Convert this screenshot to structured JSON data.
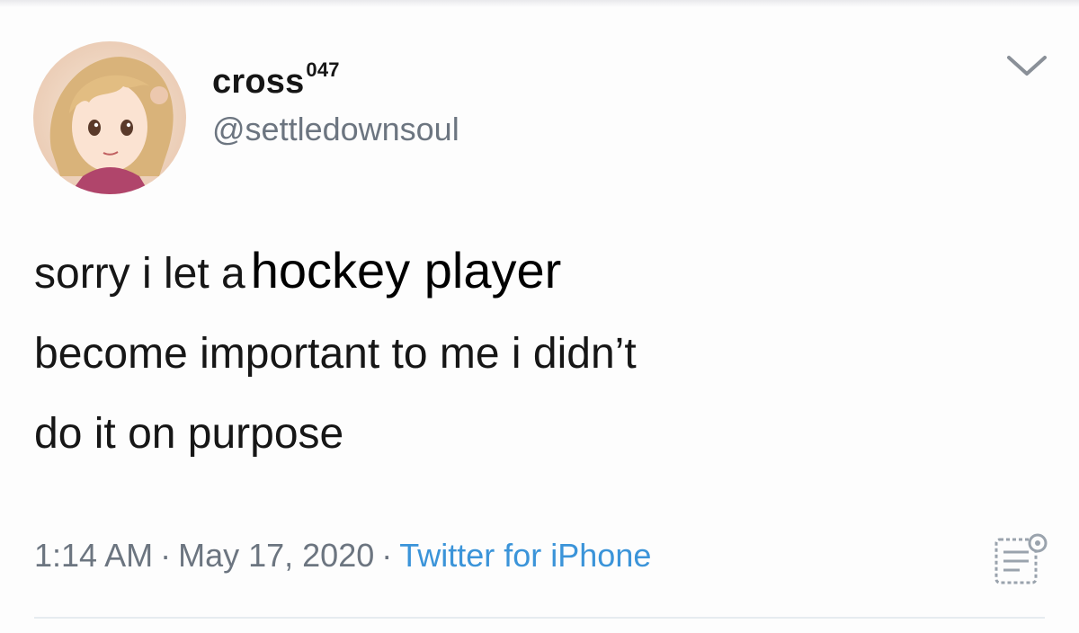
{
  "user": {
    "display_name": "cross",
    "name_superscript": "047",
    "handle": "@settledownsoul"
  },
  "tweet": {
    "line1_prefix": "sorry i let a",
    "line1_edit": "hockey player",
    "line2": "become important to me i didn’t",
    "line3": "do it on purpose"
  },
  "meta": {
    "time": "1:14 AM",
    "date": "May 17, 2020",
    "source": "Twitter for iPhone",
    "separator": "·"
  },
  "icons": {
    "menu": "chevron-down-icon",
    "analytics": "analytics-icon",
    "avatar": "anime-portrait-avatar"
  },
  "colors": {
    "text": "#161616",
    "muted": "#6c7580",
    "link": "#3b94d9"
  }
}
